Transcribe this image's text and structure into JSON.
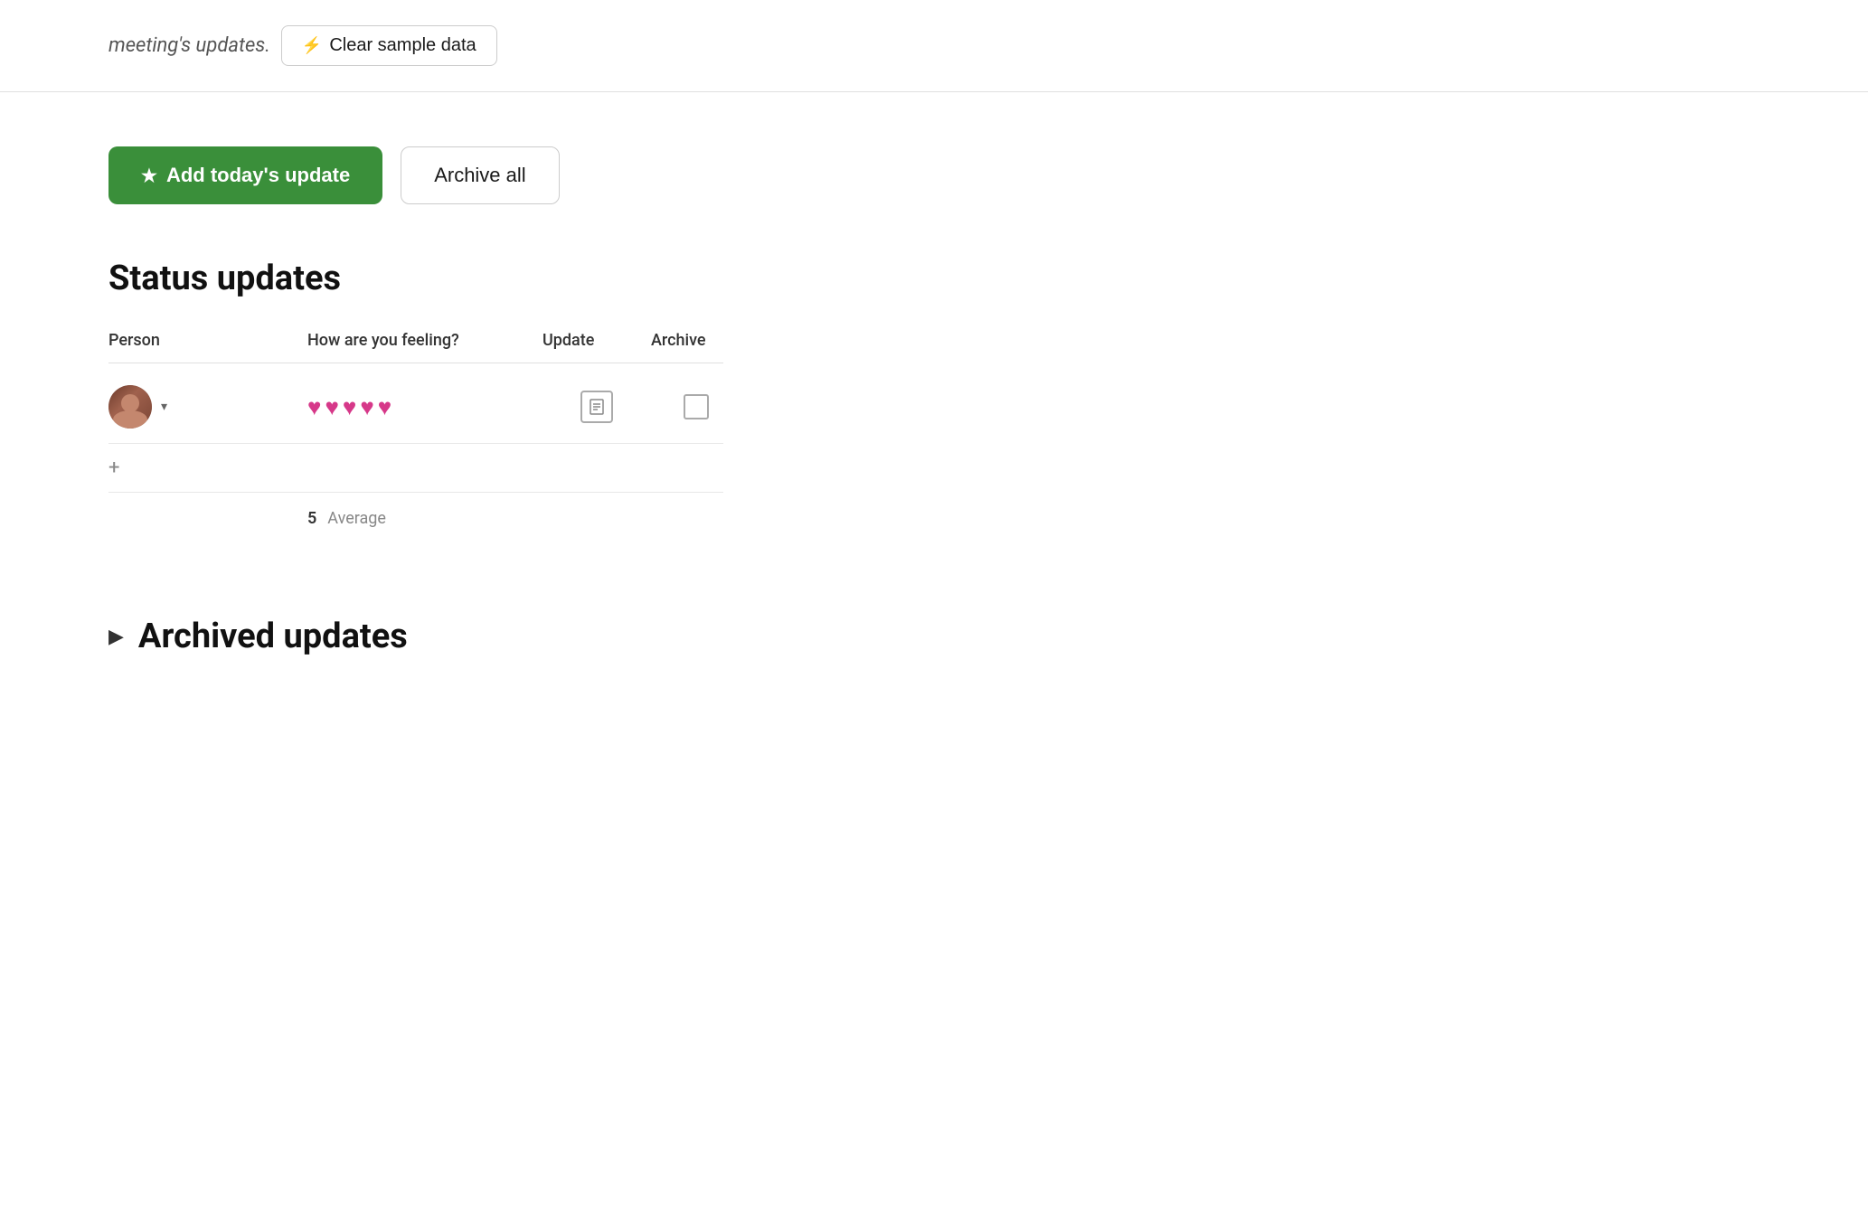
{
  "topBar": {
    "meetingText": "meeting's updates.",
    "clearBtn": {
      "boltSymbol": "⚡",
      "label": "Clear sample data"
    }
  },
  "actions": {
    "addUpdateBtn": {
      "starSymbol": "★",
      "label": "Add today's update"
    },
    "archiveAllBtn": {
      "label": "Archive all"
    }
  },
  "statusUpdates": {
    "title": "Status updates",
    "table": {
      "headers": [
        "Person",
        "How are you feeling?",
        "Update",
        "Archive"
      ],
      "rows": [
        {
          "hearts": [
            "♥",
            "♥",
            "♥",
            "♥",
            "♥"
          ],
          "heartCount": 5
        }
      ],
      "addRowSymbol": "+",
      "summary": {
        "number": "5",
        "label": "Average"
      }
    }
  },
  "archivedUpdates": {
    "triangleSymbol": "▶",
    "title": "Archived updates"
  },
  "colors": {
    "addBtnBg": "#3a8f3a",
    "heartColor": "#d63889"
  }
}
